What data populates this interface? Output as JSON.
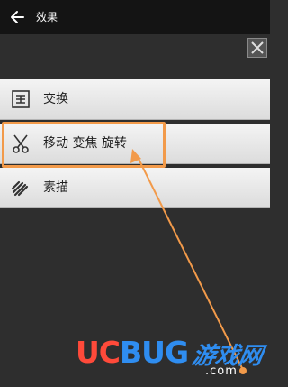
{
  "header": {
    "title": "效果"
  },
  "menu": {
    "items": [
      {
        "label": "交换",
        "icon": "swap-frame-icon"
      },
      {
        "label": "移动 变焦 旋转",
        "icon": "scissors-icon"
      },
      {
        "label": "素描",
        "icon": "sketch-brush-icon"
      }
    ]
  },
  "annotation": {
    "color": "#f29a4a"
  },
  "watermark": {
    "logo_part1": "UC",
    "logo_part2": "BUG",
    "logo_cn": "游戏网",
    "domain": ".com"
  }
}
